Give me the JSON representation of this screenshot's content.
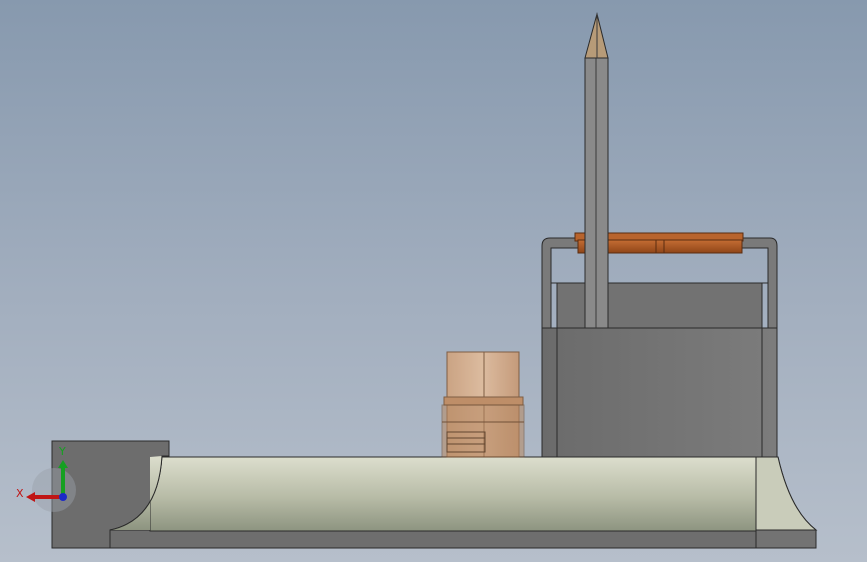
{
  "viewport": {
    "background_top": "#8799ae",
    "background_bottom": "#b6bfcb"
  },
  "model": {
    "colors": {
      "base_highlight": "#d2d5c2",
      "base_shadow": "#8f9683",
      "body_gray": "#6f6f6f",
      "frame_gray": "#7a7a7a",
      "edge": "#2a2a2a",
      "pin_gray": "#8a8a8a",
      "wood_bar": "#a85a28",
      "wood_bar_dark": "#6b3414",
      "transparent_part": "#d6a984"
    }
  },
  "triad": {
    "x_label": "X",
    "y_label": "Y",
    "x_color": "#c01515",
    "y_color": "#15a021",
    "z_color": "#1c2ac8"
  }
}
